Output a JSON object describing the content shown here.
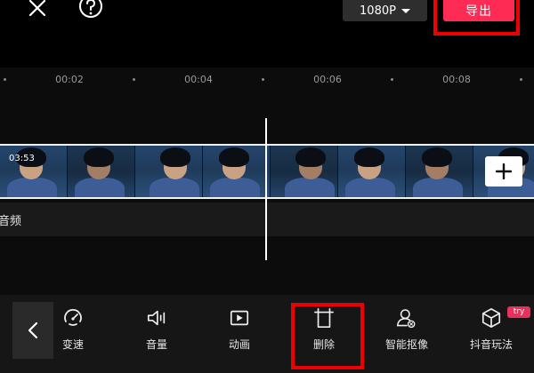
{
  "topbar": {
    "close_icon": "close-icon",
    "help_icon": "help-icon",
    "resolution": "1080P",
    "export_label": "导出",
    "export_color": "#fe2c55",
    "highlight_color": "#ee0000"
  },
  "timeline": {
    "ruler_labels": [
      "00:02",
      "00:04",
      "00:06",
      "00:08"
    ],
    "clip_duration": "03:53",
    "audio_label": "音频",
    "add_icon": "plus-icon"
  },
  "toolbar": {
    "back_icon": "chevron-left-icon",
    "tools": [
      {
        "label": "变速",
        "icon": "speed-icon"
      },
      {
        "label": "音量",
        "icon": "volume-icon"
      },
      {
        "label": "动画",
        "icon": "animation-icon"
      },
      {
        "label": "删除",
        "icon": "delete-icon"
      },
      {
        "label": "智能抠像",
        "icon": "smart-cutout-icon"
      },
      {
        "label": "抖音玩法",
        "icon": "douyin-effects-icon"
      }
    ],
    "try_badge": "try"
  }
}
